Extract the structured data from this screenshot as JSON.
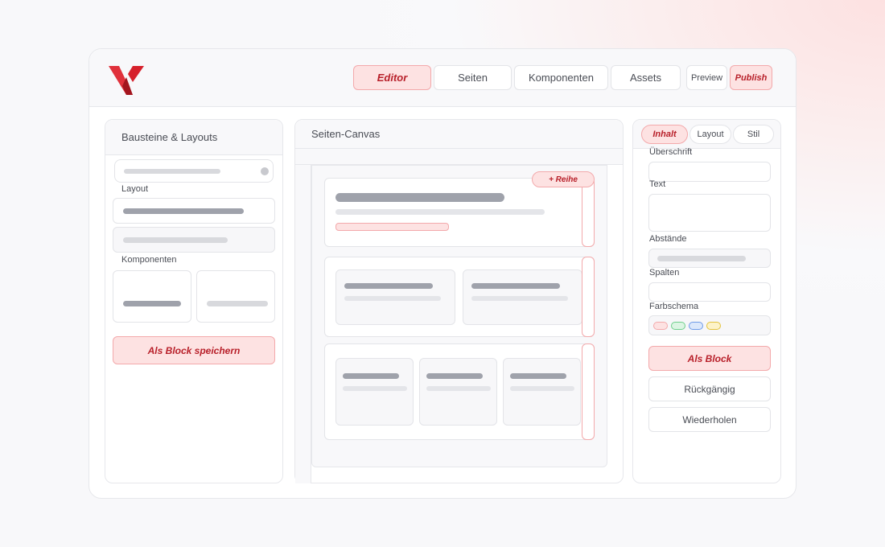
{
  "nav": {
    "tabs": [
      "Editor",
      "Seiten",
      "Komponenten",
      "Assets"
    ],
    "preview": "Preview",
    "publish": "Publish"
  },
  "left_panel": {
    "title": "Bausteine & Layouts",
    "layout_label": "Layout",
    "components_label": "Komponenten",
    "save_block": "Als Block speichern"
  },
  "canvas": {
    "title": "Seiten-Canvas",
    "add_row": "+ Reihe"
  },
  "right_panel": {
    "tabs": [
      "Inhalt",
      "Layout",
      "Stil"
    ],
    "heading_label": "Überschrift",
    "text_label": "Text",
    "spacing_label": "Abstände",
    "columns_label": "Spalten",
    "color_scheme_label": "Farbschema",
    "as_block": "Als Block",
    "undo": "Rückgängig",
    "redo": "Wiederholen"
  },
  "colors": {
    "accent": "#b8202a",
    "accent_bg": "#fde2e2",
    "swatches": [
      "#fde2e2",
      "#dcf5e3",
      "#dce8fb",
      "#fdf3c8"
    ]
  }
}
